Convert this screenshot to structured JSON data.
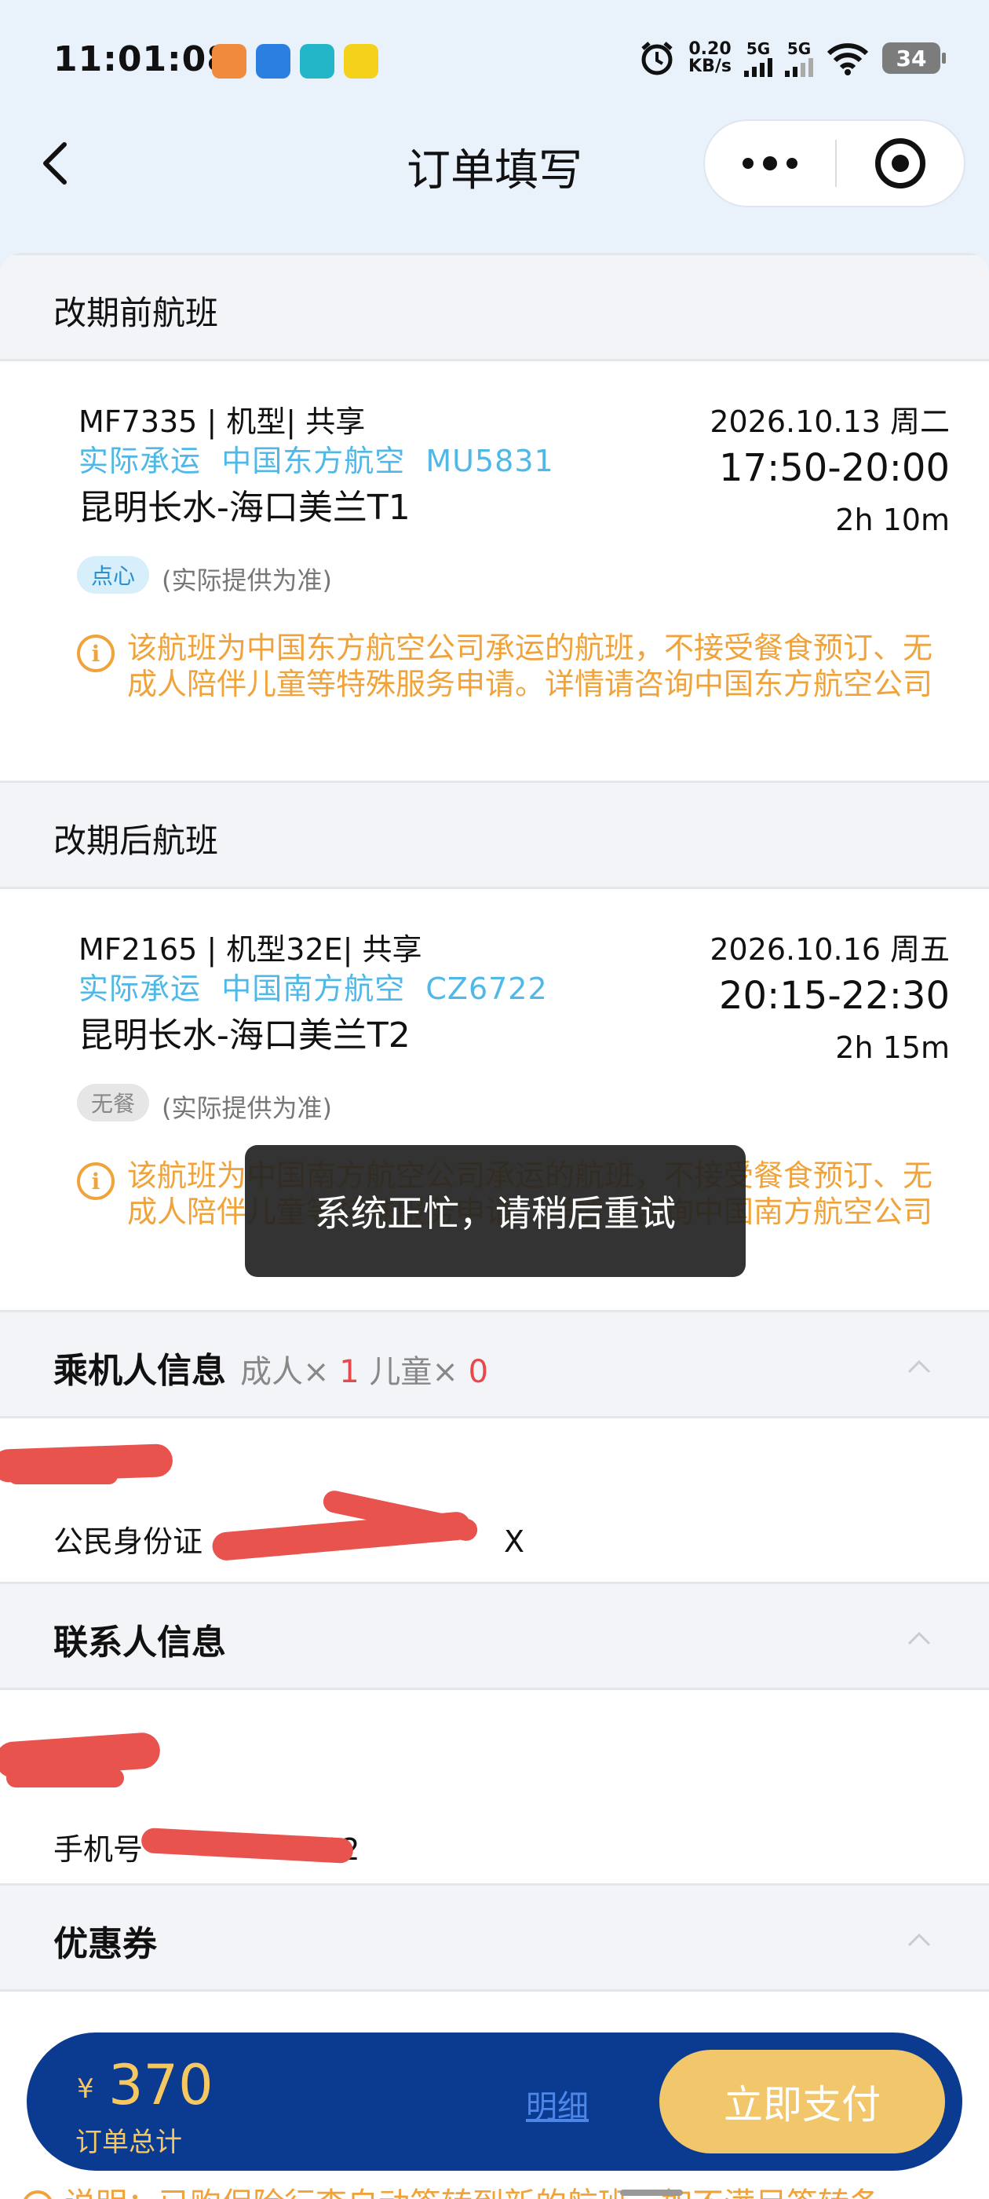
{
  "status_bar": {
    "time": "11:01:08",
    "speed_value": "0.20",
    "speed_unit": "KB/s",
    "network1": "5G",
    "network2": "5G",
    "battery": "34"
  },
  "nav": {
    "title": "订单填写"
  },
  "before": {
    "header": "改期前航班",
    "code": "MF7335 | 机型| 共享",
    "carrier_label": "实际承运",
    "carrier_name": "中国东方航空",
    "carrier_flight": "MU5831",
    "route": "昆明长水-海口美兰T1",
    "date": "2026.10.13 周二",
    "time": "17:50-20:00",
    "duration": "2h 10m",
    "meal": "点心",
    "meal_note": "(实际提供为准)",
    "warning": "该航班为中国东方航空公司承运的航班，不接受餐食预订、无成人陪伴儿童等特殊服务申请。详情请咨询中国东方航空公司"
  },
  "after": {
    "header": "改期后航班",
    "code": "MF2165 | 机型32E| 共享",
    "carrier_label": "实际承运",
    "carrier_name": "中国南方航空",
    "carrier_flight": "CZ6722",
    "route": "昆明长水-海口美兰T2",
    "date": "2026.10.16 周五",
    "time": "20:15-22:30",
    "duration": "2h 15m",
    "meal": "无餐",
    "meal_note": "(实际提供为准)",
    "warning": "该航班为中国南方航空公司承运的航班，不接受餐食预订、无成人陪伴儿童等特殊服务申请。详情请咨询中国南方航空公司"
  },
  "toast": "系统正忙，请稍后重试",
  "passenger": {
    "header": "乘机人信息",
    "adult_label": "成人×",
    "adult_count": "1",
    "child_label": "儿童×",
    "child_count": "0",
    "id_label": "公民身份证",
    "id_tail": "X"
  },
  "contact": {
    "header": "联系人信息",
    "phone_label": "手机号",
    "phone_tail": "02"
  },
  "coupon": {
    "header": "优惠券"
  },
  "paybar": {
    "currency": "¥",
    "price": "370",
    "total_label": "订单总计",
    "detail": "明细",
    "pay": "立即支付"
  },
  "bottom_note": "说明：已购保险行李自动签转到新的航班，如不满足签转条",
  "colors": {
    "accent_blue": "#4fb8e6",
    "warning_orange": "#f0a33a",
    "pay_bar": "#0b3a91",
    "pay_button": "#f2c66a"
  }
}
